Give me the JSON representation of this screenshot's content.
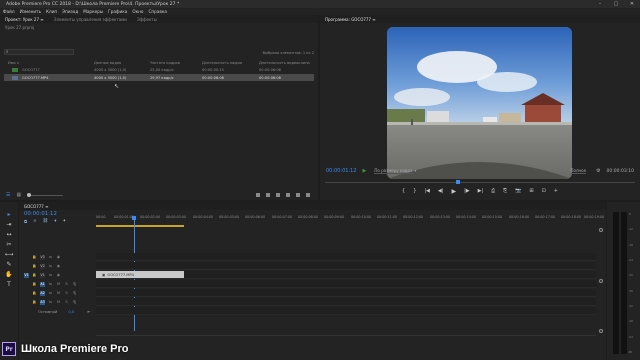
{
  "window": {
    "title": "Adobe Premiere Pro CC 2018 - D:\\Школа Premiere Pro\\4. Проекты\\Урок 27 *",
    "controls": [
      "–",
      "▢",
      "✕"
    ]
  },
  "menu": [
    "Файл",
    "Изменить",
    "Клип",
    "Эпизод",
    "Маркеры",
    "Графика",
    "Окно",
    "Справка"
  ],
  "project_panel": {
    "tabs": [
      "Проект: Урок 27 ≡",
      "Элементы управления эффектами",
      "Эффекты"
    ],
    "subtitle": "Урок 27.prproj",
    "item_count": "Выбрано элементов: 1 из 2",
    "columns": [
      "Имя ∧",
      "Данные видео",
      "Частота кадров",
      "Длительность медиа",
      "Длительность видеоклипа"
    ],
    "rows": [
      {
        "name": "GOCO777",
        "video": "4000 x 3000 (1,0)",
        "fps": "25,00 кадр/с",
        "media_dur": "00:00:00:15",
        "clip_dur": "00:00:06:06"
      },
      {
        "name": "GOCO777.MP4",
        "video": "4000 x 3000 (1,0)",
        "fps": "29,97 кадр/с",
        "media_dur": "00:00:06:06",
        "clip_dur": "00:00:06:06"
      }
    ],
    "footer_icons": [
      "list-view-icon",
      "icon-view-icon",
      "zoom-slider"
    ]
  },
  "program_monitor": {
    "tab": "Программа: GOCO777 ≡",
    "timecode": "00:00:01:12",
    "fit": "По размеру кадра",
    "quality": "Полное",
    "duration": "00:00:03:10",
    "controls": [
      "{",
      "}",
      "|◀",
      "◀|",
      "▶",
      "|▶",
      "▶|",
      "⎙",
      "⎘",
      "📷",
      "⊞",
      "⊡",
      "+"
    ]
  },
  "tools": [
    "▸",
    "⇥",
    "↔",
    "✂",
    "⟷",
    "✎",
    "✋",
    "T"
  ],
  "timeline": {
    "tab": "GOCO777 ≡",
    "timecode": "00:00:01:12",
    "ruler": [
      "00:00",
      "00:00:01:00",
      "00:00:02:00",
      "00:00:03:00",
      "00:00:04:00",
      "00:00:05:00",
      "00:00:06:00",
      "00:00:07:00",
      "00:00:08:00",
      "00:00:09:00",
      "00:00:10:00",
      "00:00:11:00",
      "00:00:12:00",
      "00:00:13:00",
      "00:00:14:00",
      "00:00:15:00",
      "00:00:16:00",
      "00:00:17:00",
      "00:00:18:00",
      "00:00:19:00"
    ],
    "tracks": [
      {
        "id": "V3",
        "src": false,
        "kind": "video"
      },
      {
        "id": "V2",
        "src": false,
        "kind": "video"
      },
      {
        "id": "V1",
        "src": true,
        "kind": "video"
      },
      {
        "id": "A1",
        "src": true,
        "kind": "audio"
      },
      {
        "id": "A2",
        "src": false,
        "kind": "audio"
      },
      {
        "id": "A3",
        "src": false,
        "kind": "audio"
      }
    ],
    "master_label": "Основной",
    "master_value": "0,0",
    "clip_label": "GOCO777.MP4"
  },
  "meters": {
    "labels": [
      "-6",
      "-12",
      "-18",
      "-24",
      "-30",
      "-36",
      "-42",
      "-48",
      "-54",
      "dB"
    ]
  },
  "brand": {
    "logo": "Pr",
    "name": "Школа Premiere Pro"
  }
}
